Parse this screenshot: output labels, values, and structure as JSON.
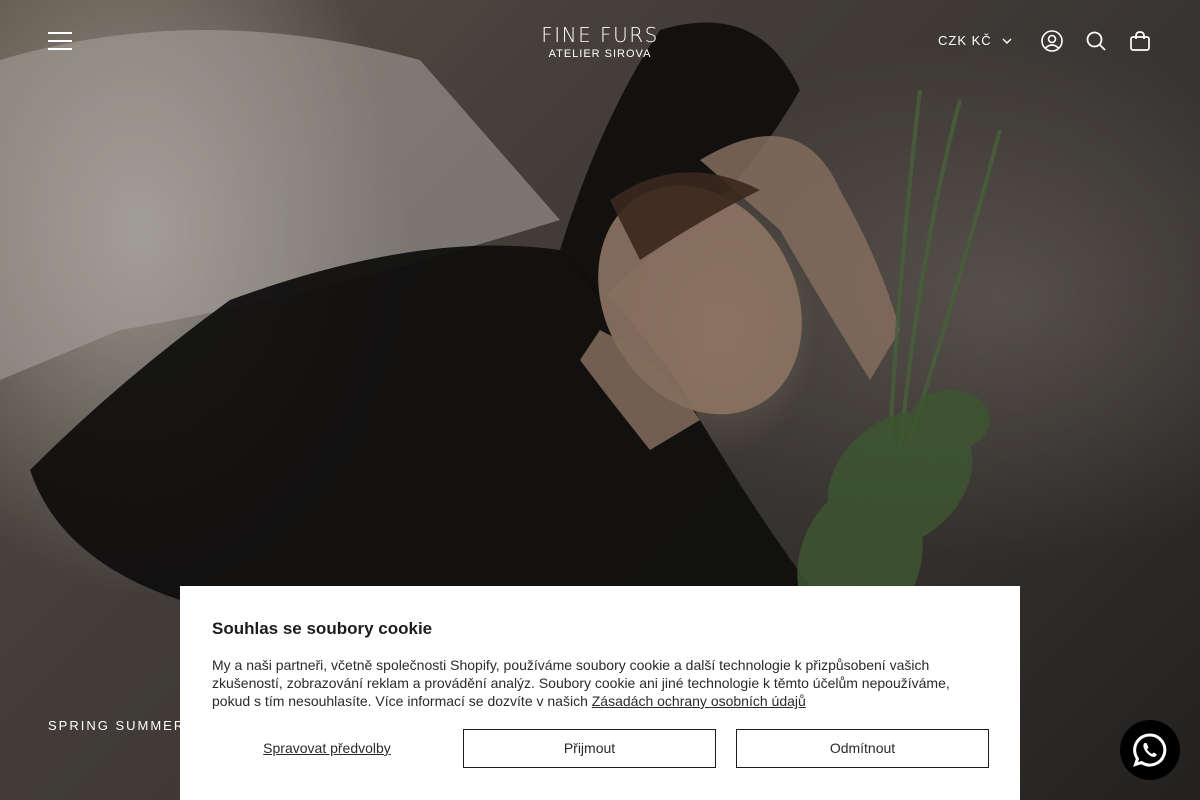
{
  "brand": {
    "name": "FINE FURS",
    "subtitle": "ATELIER SIROVA"
  },
  "header": {
    "menu_icon": "hamburger-menu-icon",
    "currency": "CZK Kč",
    "icons": [
      "account-icon",
      "search-icon",
      "cart-icon"
    ]
  },
  "hero": {
    "collection_label": "SPRING SUMMER"
  },
  "cookie_banner": {
    "title": "Souhlas se soubory cookie",
    "text": "My a naši partneři, včetně společnosti Shopify, používáme soubory cookie a další technologie k přizpůsobení vašich zkušeností, zobrazování reklam a provádění analýz. Soubory cookie ani jiné technologie k těmto účelům nepoužíváme, pokud s tím nesouhlasíte. Více informací se dozvíte v našich",
    "policy_link": "Zásadách ochrany osobních údajů",
    "manage_label": "Spravovat předvolby",
    "accept_label": "Přijmout",
    "decline_label": "Odmítnout"
  },
  "chat_button": {
    "icon": "whatsapp-icon"
  }
}
